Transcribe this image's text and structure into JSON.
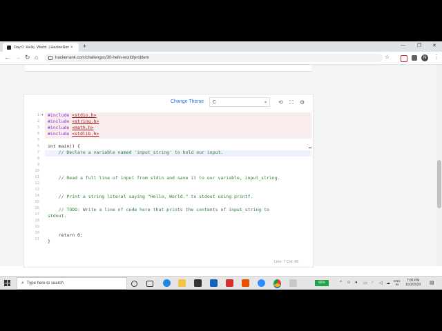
{
  "browser": {
    "tab_title": "Day 0: Hello, World. | HackerRan",
    "tab_close": "×",
    "new_tab": "+",
    "url": "hackerrank.com/challenges/30-hello-world/problem",
    "profile_initial": "N"
  },
  "editor": {
    "change_theme_label": "Change Theme",
    "language": "C",
    "status": "Line: 7 Col: 66",
    "line_numbers": [
      "1",
      "2",
      "3",
      "4",
      "5",
      "6",
      "7",
      "8",
      "9",
      "10",
      "11",
      "12",
      "13",
      "14",
      "15",
      "16",
      "17",
      "18",
      "19",
      "20",
      "21"
    ],
    "lines": {
      "l1_kw": "#include",
      "l1_arg": "<stdio.h>",
      "l2_kw": "#include",
      "l2_arg": "<string.h>",
      "l3_kw": "#include",
      "l3_arg": "<math.h>",
      "l4_kw": "#include",
      "l4_arg": "<stdlib.h>",
      "l6": "int main() {",
      "l7": "    // Declare a variable named 'input_string' to hold our input.",
      "l11": "    // Read a full line of input from stdin and save it to our variable, input_string.",
      "l14": "    // Print a string literal saying \"Hello, World.\" to stdout using printf.",
      "l16a": "    // TODO: Write a line of code here that prints the contents of input_string to",
      "l16b": "stdout.",
      "l19": "    return 0;",
      "l20": "}"
    }
  },
  "taskbar": {
    "search_placeholder": "Type here to search",
    "battery": "66%",
    "lang_top": "ENG",
    "lang_bottom": "IN",
    "time": "7:06 PM",
    "date": "10/3/2020"
  },
  "colors": {
    "accent": "#1a73e8",
    "comment": "#2e7d32",
    "include_bg": "#f8ecec"
  }
}
